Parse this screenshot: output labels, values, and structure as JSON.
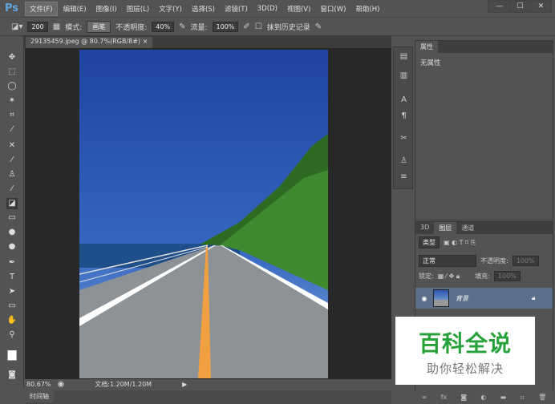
{
  "app": {
    "logo": "Ps"
  },
  "menu": [
    "文件(F)",
    "编辑(E)",
    "图像(I)",
    "图层(L)",
    "文字(Y)",
    "选择(S)",
    "滤镜(T)",
    "3D(D)",
    "视图(V)",
    "窗口(W)",
    "帮助(H)"
  ],
  "window_controls": [
    "—",
    "☐",
    "✕"
  ],
  "options": {
    "brush_size": "200",
    "mode_label": "模式:",
    "mode_value": "画笔",
    "opacity_label": "不透明度:",
    "opacity_value": "40%",
    "flow_label": "流量:",
    "flow_value": "100%",
    "erase_history_label": "抹到历史记录"
  },
  "document": {
    "tab": "29135459.jpeg @ 80.7%(RGB/8#)",
    "close": "×"
  },
  "status": {
    "zoom": "80.67%",
    "doc": "文档:1.20M/1.20M"
  },
  "timeline": "时间轴",
  "properties": {
    "tab": "属性",
    "content": "无属性"
  },
  "layers": {
    "tabs": [
      "3D",
      "图层",
      "通道"
    ],
    "filter": "类型",
    "blend_mode": "正常",
    "opacity_label": "不透明度:",
    "opacity_value": "100%",
    "lock_label": "锁定:",
    "fill_label": "填充:",
    "fill_value": "100%",
    "layer_name": "背景"
  },
  "watermark": {
    "title": "百科全说",
    "subtitle": "助你轻松解决"
  },
  "colors": {
    "chrome": "#535353",
    "canvas": "#282828",
    "accent": "#5ea6e0",
    "selected_layer": "#5b6e8a",
    "watermark_green": "#27a13a"
  }
}
